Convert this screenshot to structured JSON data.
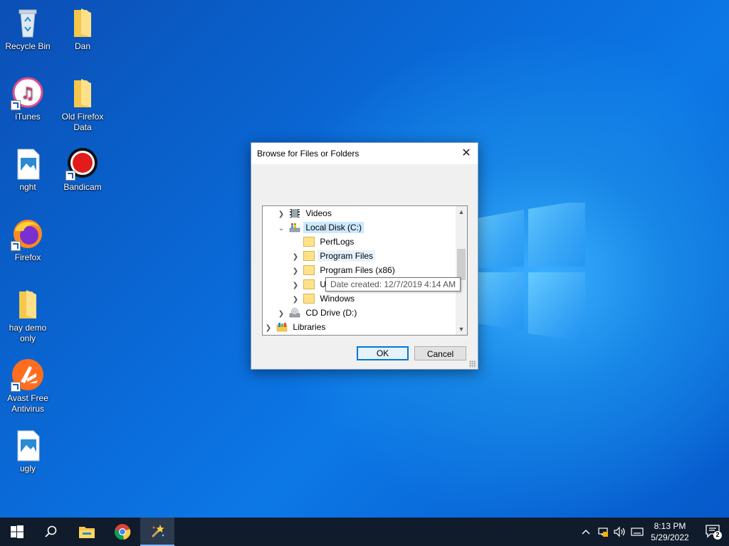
{
  "desktop": {
    "icons": [
      {
        "label": "Recycle Bin",
        "icon": "recycle-bin-icon"
      },
      {
        "label": "Dan",
        "icon": "folder-icon"
      },
      {
        "label": "iTunes",
        "icon": "itunes-icon"
      },
      {
        "label": "Old Firefox Data",
        "icon": "folder-icon"
      },
      {
        "label": "nght",
        "icon": "image-file-icon"
      },
      {
        "label": "Bandicam",
        "icon": "bandicam-icon"
      },
      {
        "label": "Firefox",
        "icon": "firefox-icon"
      },
      {
        "label": "hay demo only",
        "icon": "folder-icon"
      },
      {
        "label": "Avast Free Antivirus",
        "icon": "avast-icon"
      },
      {
        "label": "ugly",
        "icon": "image-file-icon"
      }
    ]
  },
  "dialog": {
    "title": "Browse for Files or Folders",
    "tree": [
      {
        "label": "Videos",
        "expander": "collapsed",
        "icon": "videos-icon"
      },
      {
        "label": "Local Disk (C:)",
        "expander": "expanded",
        "icon": "local-disk-icon",
        "state": "selected"
      },
      {
        "label": "PerfLogs",
        "expander": "none",
        "icon": "folder-icon"
      },
      {
        "label": "Program Files",
        "expander": "collapsed",
        "icon": "folder-icon",
        "state": "hover"
      },
      {
        "label": "Program Files (x86)",
        "expander": "collapsed",
        "icon": "folder-icon"
      },
      {
        "label": "Us",
        "expander": "collapsed",
        "icon": "folder-icon"
      },
      {
        "label": "Windows",
        "expander": "collapsed",
        "icon": "folder-icon"
      },
      {
        "label": "CD Drive (D:)",
        "expander": "collapsed",
        "icon": "cd-drive-icon"
      },
      {
        "label": "Libraries",
        "expander": "collapsed",
        "icon": "libraries-icon"
      }
    ],
    "tooltip": "Date created: 12/7/2019 4:14 AM",
    "ok_label": "OK",
    "cancel_label": "Cancel"
  },
  "taskbar": {
    "start_icon": "windows-start-icon",
    "search_icon": "search-icon",
    "pinned": [
      "file-explorer-icon",
      "chrome-icon",
      "wand-app-icon"
    ],
    "tray_icons": [
      "chevron-up-icon",
      "network-icon",
      "volume-icon",
      "keyboard-icon"
    ],
    "time": "8:13 PM",
    "date": "5/29/2022",
    "notification_count": "2"
  }
}
